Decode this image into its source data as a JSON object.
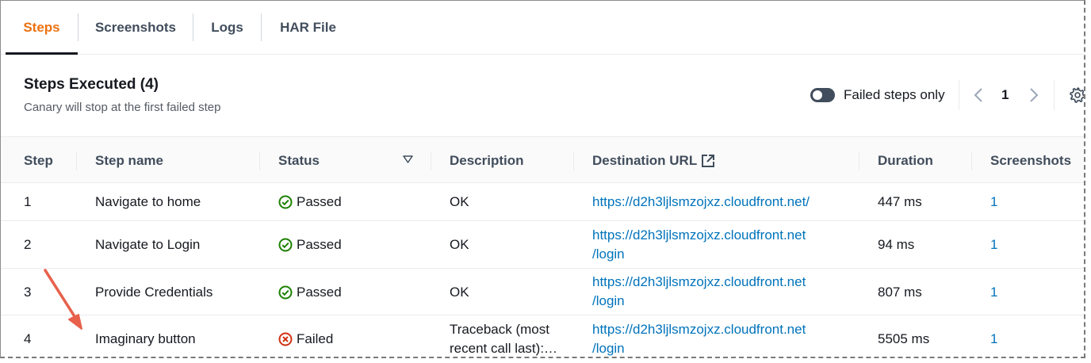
{
  "tabs": [
    {
      "label": "Steps",
      "active": true
    },
    {
      "label": "Screenshots",
      "active": false
    },
    {
      "label": "Logs",
      "active": false
    },
    {
      "label": "HAR File",
      "active": false
    }
  ],
  "header": {
    "title": "Steps Executed (4)",
    "description": "Canary will stop at the first failed step"
  },
  "filter": {
    "toggle_label": "Failed steps only",
    "toggle_on": false
  },
  "pagination": {
    "current_page": "1"
  },
  "table": {
    "columns": [
      "Step",
      "Step name",
      "Status",
      "Description",
      "Destination URL",
      "Duration",
      "Screenshots"
    ],
    "rows": [
      {
        "step": "1",
        "name": "Navigate to home",
        "status": "Passed",
        "description": "OK",
        "url_line1": "https://d2h3ljlsmzojxz.cloudfront.net/",
        "url_line2": "",
        "duration": "447 ms",
        "screenshots": "1"
      },
      {
        "step": "2",
        "name": "Navigate to Login",
        "status": "Passed",
        "description": "OK",
        "url_line1": "https://d2h3ljlsmzojxz.cloudfront.net",
        "url_line2": "/login",
        "duration": "94 ms",
        "screenshots": "1"
      },
      {
        "step": "3",
        "name": "Provide Credentials",
        "status": "Passed",
        "description": "OK",
        "url_line1": "https://d2h3ljlsmzojxz.cloudfront.net",
        "url_line2": "/login",
        "duration": "807 ms",
        "screenshots": "1"
      },
      {
        "step": "4",
        "name": "Imaginary button",
        "status": "Failed",
        "description_line1": "Traceback (most",
        "description_line2": "recent call last):…",
        "url_line1": "https://d2h3ljlsmzojxz.cloudfront.net",
        "url_line2": "/login",
        "duration": "5505 ms",
        "screenshots": "1"
      }
    ]
  },
  "colors": {
    "active_tab": "#ec7211",
    "link": "#0073bb",
    "passed": "#1d8102",
    "failed": "#d13212",
    "annotation_arrow": "#e8604c"
  }
}
